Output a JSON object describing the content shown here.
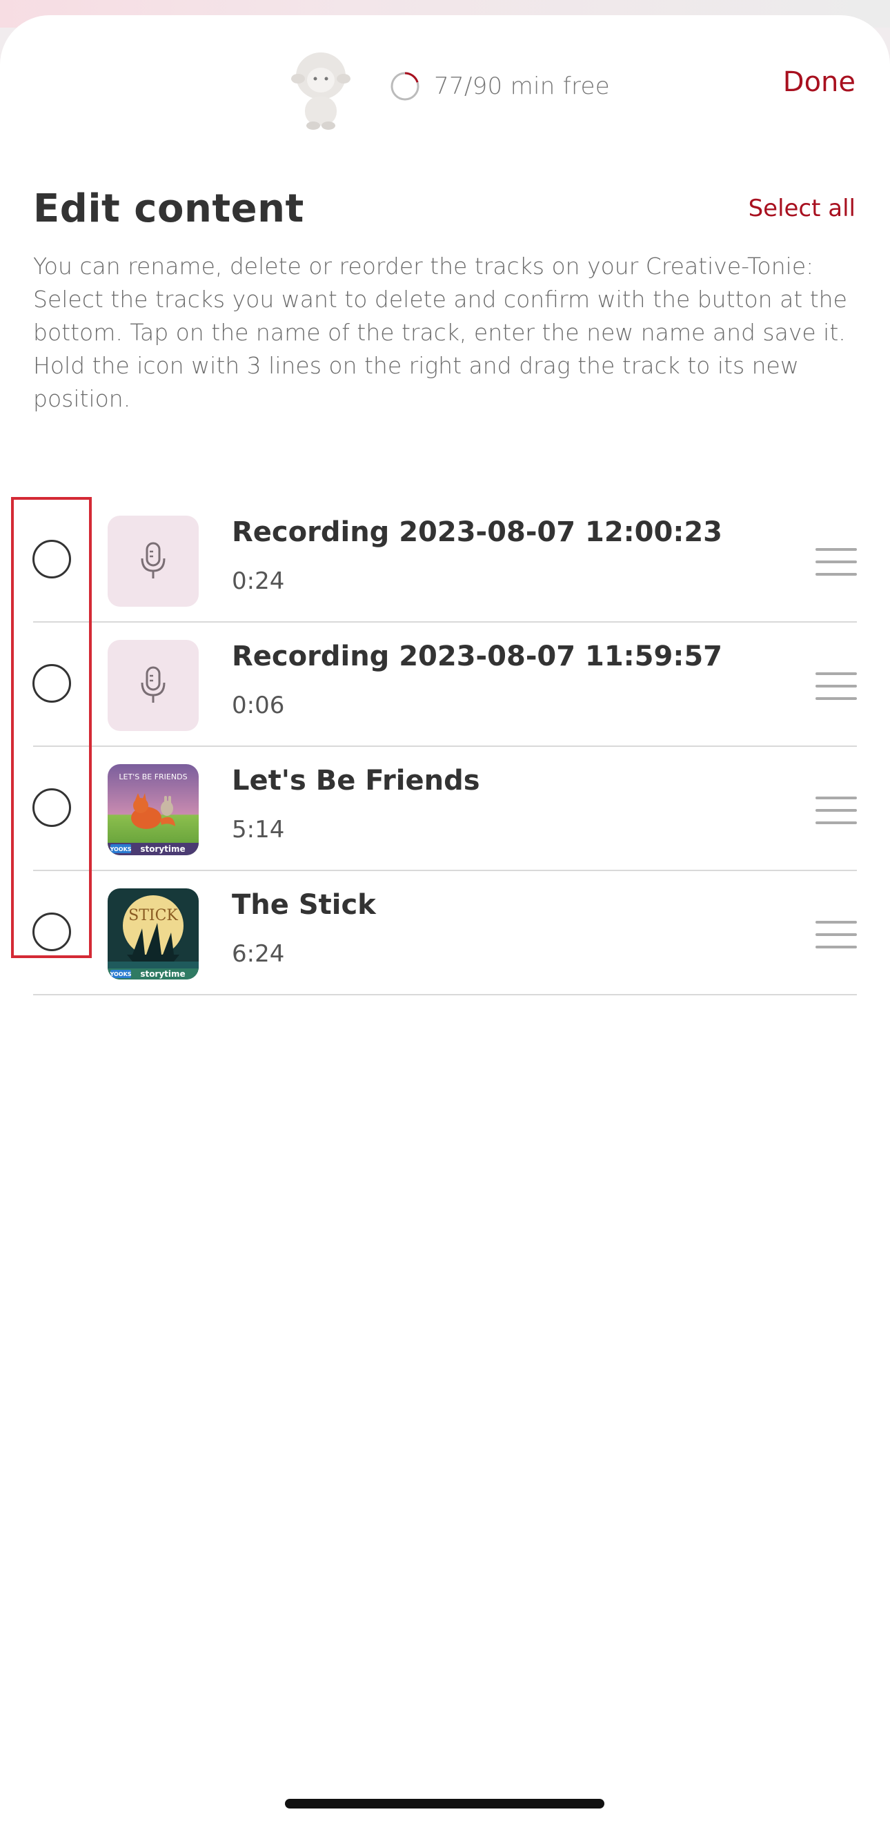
{
  "header": {
    "storage_text": "77/90 min free",
    "done_label": "Done"
  },
  "page": {
    "title": "Edit content",
    "select_all_label": "Select all",
    "description": "You can rename, delete or reorder the tracks on your Creative-Tonie: Select the tracks you want to delete and confirm with the button at the bottom. Tap on the name of the track, enter the new name and save it. Hold the icon with 3 lines on the right and drag the track to its new position."
  },
  "tracks": [
    {
      "title": "Recording 2023-08-07 12:00:23",
      "duration": "0:24",
      "thumbnail": "microphone-icon"
    },
    {
      "title": "Recording 2023-08-07 11:59:57",
      "duration": "0:06",
      "thumbnail": "microphone-icon"
    },
    {
      "title": "Let's Be Friends",
      "duration": "5:14",
      "thumbnail": "cover-lets-be-friends",
      "cover_text": "LET'S BE FRIENDS",
      "cover_badge_left": "YOOKS",
      "cover_badge_right": "storytime"
    },
    {
      "title": "The Stick",
      "duration": "6:24",
      "thumbnail": "cover-the-stick",
      "cover_text": "STICK",
      "cover_badge_left": "YOOKS",
      "cover_badge_right": "storytime"
    }
  ],
  "colors": {
    "accent": "#a8101f",
    "highlight": "#d42a35",
    "mic_tile": "#f2e4eb"
  }
}
